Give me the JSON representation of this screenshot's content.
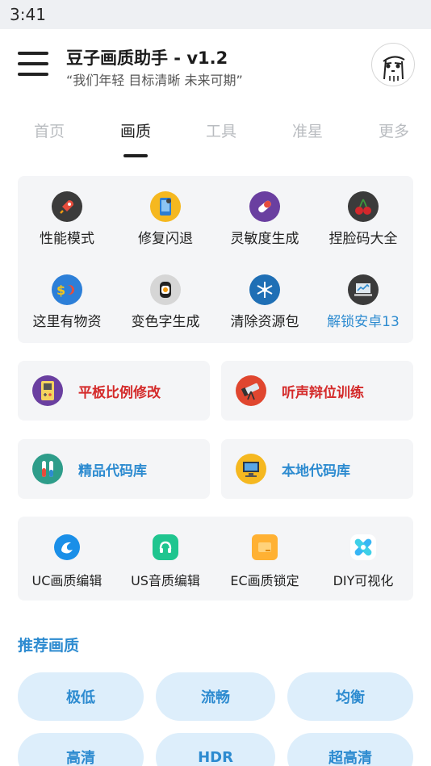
{
  "status_bar": {
    "time": "3:41"
  },
  "header": {
    "title": "豆子画质助手 - v1.2",
    "subtitle": "“我们年轻 目标清晰 未来可期”"
  },
  "tabs": [
    {
      "label": "首页",
      "active": false
    },
    {
      "label": "画质",
      "active": true
    },
    {
      "label": "工具",
      "active": false
    },
    {
      "label": "准星",
      "active": false
    },
    {
      "label": "更多",
      "active": false
    }
  ],
  "grid_tools": [
    {
      "label": "性能模式",
      "icon": "rocket-icon"
    },
    {
      "label": "修复闪退",
      "icon": "phone-repair-icon"
    },
    {
      "label": "灵敏度生成",
      "icon": "pill-icon"
    },
    {
      "label": "捏脸码大全",
      "icon": "cherry-icon"
    },
    {
      "label": "这里有物资",
      "icon": "money-magnet-icon"
    },
    {
      "label": "变色字生成",
      "icon": "sushi-icon"
    },
    {
      "label": "清除资源包",
      "icon": "snowflake-icon"
    },
    {
      "label": "解锁安卓13",
      "icon": "laptop-icon",
      "color": "#2d8bd0"
    }
  ],
  "feature_cards": [
    {
      "label": "平板比例修改",
      "icon": "gameboy-icon",
      "color": "#d42a2a"
    },
    {
      "label": "听声辩位训练",
      "icon": "telescope-icon",
      "color": "#d42a2a"
    },
    {
      "label": "精品代码库",
      "icon": "test-tube-icon",
      "color": "#2d8bd0"
    },
    {
      "label": "本地代码库",
      "icon": "computer-icon",
      "color": "#2d8bd0"
    }
  ],
  "quality_editors": [
    {
      "label": "UC画质编辑",
      "icon": "uc-browser-icon"
    },
    {
      "label": "US音质编辑",
      "icon": "headphones-icon"
    },
    {
      "label": "EC画质锁定",
      "icon": "ec-lock-icon"
    },
    {
      "label": "DIY可视化",
      "icon": "diy-pinwheel-icon"
    }
  ],
  "recommended": {
    "title": "推荐画质",
    "options": [
      "极低",
      "流畅",
      "均衡",
      "高清",
      "HDR",
      "超高清"
    ]
  },
  "colors": {
    "accent": "#2d8bd0",
    "warning": "#d42a2a",
    "card_bg": "#f4f5f7",
    "pill_bg": "#ddeefb"
  }
}
